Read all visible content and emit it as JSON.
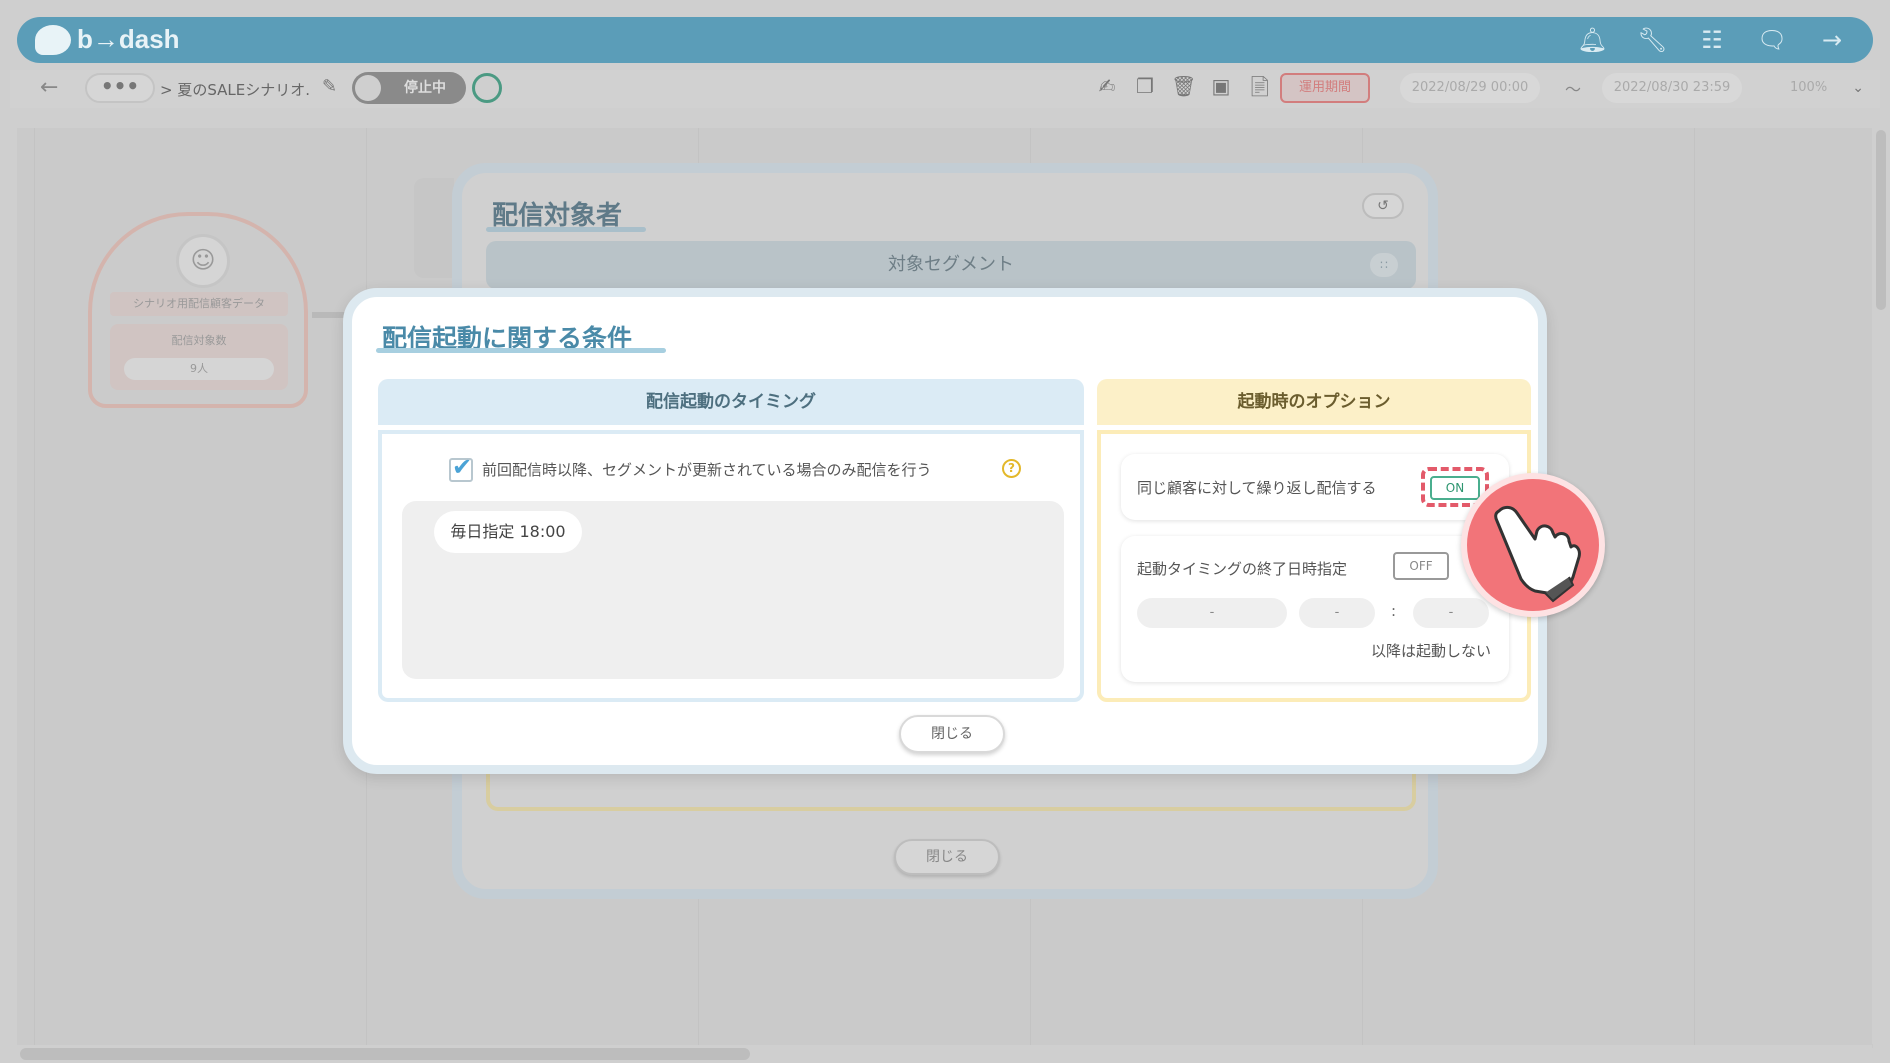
{
  "app": {
    "logo_text": "b→dash"
  },
  "topbar": {
    "icons": [
      "bell-icon",
      "wrench-icon",
      "grid-icon",
      "chat-icon",
      "logout-icon"
    ]
  },
  "subbar": {
    "more": "•••",
    "breadcrumb": "> 夏のSALEシナリオ.",
    "status_label": "停止中",
    "period_label": "運用期間",
    "start_date": "2022/08/29 00:00",
    "tilde": "〜",
    "end_date": "2022/08/30 23:59",
    "zoom": "100%"
  },
  "node": {
    "title": "シナリオ用配信顧客データ",
    "count_label": "配信対象数",
    "count_value": "9人"
  },
  "bg_modal": {
    "title": "配信対象者",
    "segment_label": "対象セグメント",
    "close_label": "閉じる"
  },
  "modal": {
    "title": "配信起動に関する条件",
    "timing": {
      "header": "配信起動のタイミング",
      "checkbox_label": "前回配信時以降、セグメントが更新されている場合のみ配信を行う",
      "checkbox_checked": true,
      "help": "?",
      "schedule_chip": "毎日指定 18:00"
    },
    "options": {
      "header": "起動時のオプション",
      "repeat_label": "同じ顧客に対して繰り返し配信する",
      "repeat_toggle": "ON",
      "end_label": "起動タイミングの終了日時指定",
      "end_toggle": "OFF",
      "date_placeholder": "-",
      "hour_placeholder": "-",
      "minute_placeholder": "-",
      "colon": ":",
      "note": "以降は起動しない"
    },
    "close_label": "閉じる"
  },
  "colors": {
    "accent": "#5b9db8",
    "highlight": "#e35a6a",
    "on": "#4aae8e"
  }
}
